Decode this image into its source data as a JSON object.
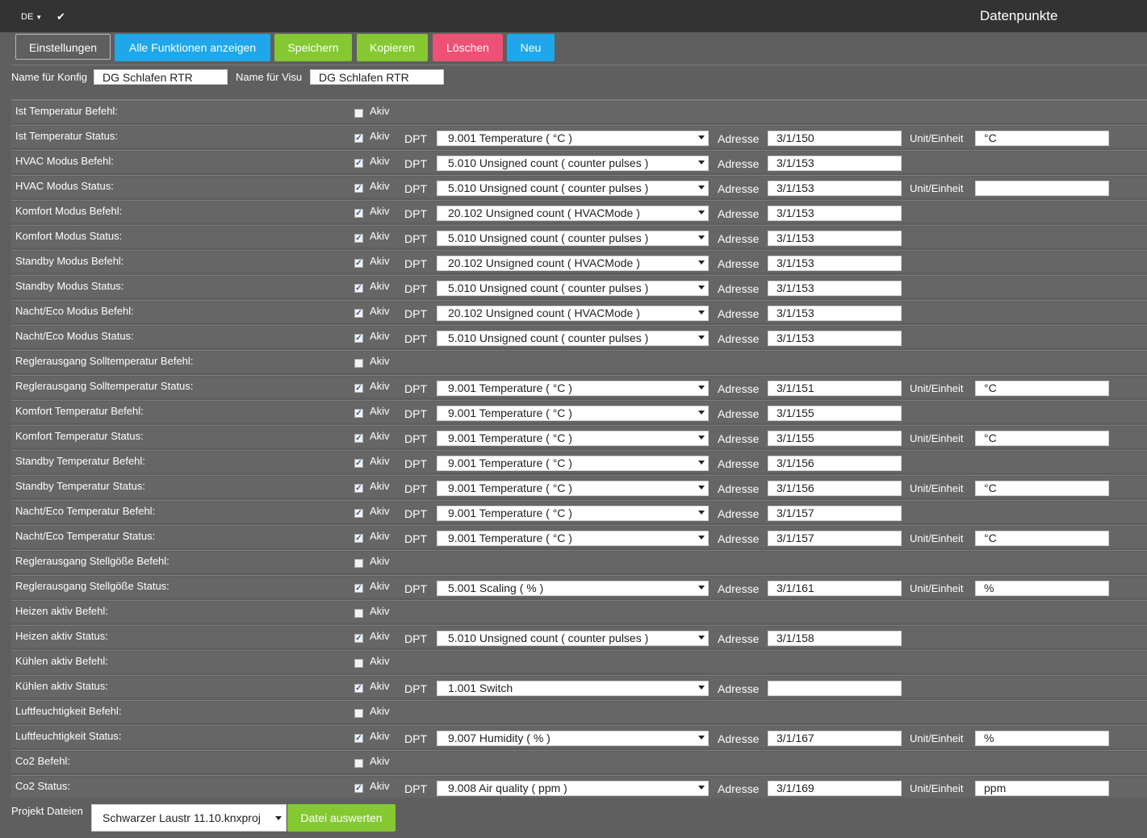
{
  "header": {
    "language": "DE",
    "title": "Datenpunkte"
  },
  "toolbar": {
    "settings": "Einstellungen",
    "show_all": "Alle Funktionen anzeigen",
    "save": "Speichern",
    "copy": "Kopieren",
    "delete": "Löschen",
    "new": "Neu"
  },
  "names": {
    "konfig_label": "Name für Konfig",
    "konfig_value": "DG Schlafen RTR",
    "visu_label": "Name für Visu",
    "visu_value": "DG Schlafen RTR"
  },
  "labels": {
    "akiv": "Akiv",
    "dpt": "DPT",
    "adresse": "Adresse",
    "unit": "Unit/Einheit"
  },
  "rows": [
    {
      "label": "Ist Temperatur Befehl:",
      "active": false,
      "dpt": "",
      "adresse": "",
      "unit": null
    },
    {
      "label": "Ist Temperatur Status:",
      "active": true,
      "dpt": "9.001 Temperature ( °C )",
      "adresse": "3/1/150",
      "unit": "°C"
    },
    {
      "label": "HVAC Modus Befehl:",
      "active": true,
      "dpt": "5.010 Unsigned count ( counter pulses )",
      "adresse": "3/1/153",
      "unit": null
    },
    {
      "label": "HVAC Modus Status:",
      "active": true,
      "dpt": "5.010 Unsigned count ( counter pulses )",
      "adresse": "3/1/153",
      "unit": ""
    },
    {
      "label": "Komfort Modus Befehl:",
      "active": true,
      "dpt": "20.102 Unsigned count ( HVACMode )",
      "adresse": "3/1/153",
      "unit": null
    },
    {
      "label": "Komfort Modus Status:",
      "active": true,
      "dpt": "5.010 Unsigned count ( counter pulses )",
      "adresse": "3/1/153",
      "unit": null
    },
    {
      "label": "Standby Modus Befehl:",
      "active": true,
      "dpt": "20.102 Unsigned count ( HVACMode )",
      "adresse": "3/1/153",
      "unit": null
    },
    {
      "label": "Standby Modus Status:",
      "active": true,
      "dpt": "5.010 Unsigned count ( counter pulses )",
      "adresse": "3/1/153",
      "unit": null
    },
    {
      "label": "Nacht/Eco Modus Befehl:",
      "active": true,
      "dpt": "20.102 Unsigned count ( HVACMode )",
      "adresse": "3/1/153",
      "unit": null
    },
    {
      "label": "Nacht/Eco Modus Status:",
      "active": true,
      "dpt": "5.010 Unsigned count ( counter pulses )",
      "adresse": "3/1/153",
      "unit": null
    },
    {
      "label": "Reglerausgang Solltemperatur Befehl:",
      "active": false,
      "dpt": "",
      "adresse": "",
      "unit": null
    },
    {
      "label": "Reglerausgang Solltemperatur Status:",
      "active": true,
      "dpt": "9.001 Temperature ( °C )",
      "adresse": "3/1/151",
      "unit": "°C"
    },
    {
      "label": "Komfort Temperatur Befehl:",
      "active": true,
      "dpt": "9.001 Temperature ( °C )",
      "adresse": "3/1/155",
      "unit": null
    },
    {
      "label": "Komfort Temperatur Status:",
      "active": true,
      "dpt": "9.001 Temperature ( °C )",
      "adresse": "3/1/155",
      "unit": "°C"
    },
    {
      "label": "Standby Temperatur Befehl:",
      "active": true,
      "dpt": "9.001 Temperature ( °C )",
      "adresse": "3/1/156",
      "unit": null
    },
    {
      "label": "Standby Temperatur Status:",
      "active": true,
      "dpt": "9.001 Temperature ( °C )",
      "adresse": "3/1/156",
      "unit": "°C"
    },
    {
      "label": "Nacht/Eco Temperatur Befehl:",
      "active": true,
      "dpt": "9.001 Temperature ( °C )",
      "adresse": "3/1/157",
      "unit": null
    },
    {
      "label": "Nacht/Eco Temperatur Status:",
      "active": true,
      "dpt": "9.001 Temperature ( °C )",
      "adresse": "3/1/157",
      "unit": "°C"
    },
    {
      "label": "Reglerausgang Stellgöße Befehl:",
      "active": false,
      "dpt": "",
      "adresse": "",
      "unit": null
    },
    {
      "label": "Reglerausgang Stellgöße Status:",
      "active": true,
      "dpt": "5.001 Scaling ( % )",
      "adresse": "3/1/161",
      "unit": "%"
    },
    {
      "label": "Heizen aktiv Befehl:",
      "active": false,
      "dpt": "",
      "adresse": "",
      "unit": null
    },
    {
      "label": "Heizen aktiv Status:",
      "active": true,
      "dpt": "5.010 Unsigned count ( counter pulses )",
      "adresse": "3/1/158",
      "unit": null
    },
    {
      "label": "Kühlen aktiv Befehl:",
      "active": false,
      "dpt": "",
      "adresse": "",
      "unit": null
    },
    {
      "label": "Kühlen aktiv Status:",
      "active": true,
      "dpt": "1.001 Switch",
      "adresse": "",
      "unit": null
    },
    {
      "label": "Luftfeuchtigkeit Befehl:",
      "active": false,
      "dpt": "",
      "adresse": "",
      "unit": null
    },
    {
      "label": "Luftfeuchtigkeit Status:",
      "active": true,
      "dpt": "9.007 Humidity ( % )",
      "adresse": "3/1/167",
      "unit": "%"
    },
    {
      "label": "Co2 Befehl:",
      "active": false,
      "dpt": "",
      "adresse": "",
      "unit": null
    },
    {
      "label": "Co2 Status:",
      "active": true,
      "dpt": "9.008 Air quality ( ppm )",
      "adresse": "3/1/169",
      "unit": "ppm"
    }
  ],
  "footer": {
    "label": "Projekt Dateien",
    "file": "Schwarzer Laustr 11.10.knxproj",
    "evaluate": "Datei auswerten"
  }
}
